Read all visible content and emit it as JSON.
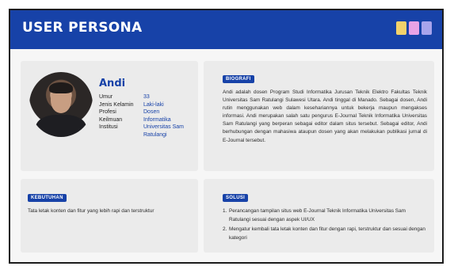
{
  "header": {
    "title": "USER PERSONA",
    "swatch_colors": [
      "#f3d26b",
      "#e8a3e6",
      "#a8a4ec"
    ]
  },
  "profile": {
    "name": "Andi",
    "attributes": [
      {
        "label": "Umur",
        "value": "33"
      },
      {
        "label": "Jenis Kelamin",
        "value": "Laki-laki"
      },
      {
        "label": "Profesi",
        "value": "Dosen"
      },
      {
        "label": "Keilmuan",
        "value": "Informatika"
      },
      {
        "label": "Institusi",
        "value": "Universitas Sam Ratulangi"
      }
    ]
  },
  "bio": {
    "badge": "BIOGRAFI",
    "text": "Andi adalah dosen Program Studi Informatika Jurusan Teknik Elektro Fakultas Teknik Universitas Sam Ratulangi Sulawesi Utara. Andi tinggal di Manado. Sebagai dosen, Andi rutin menggunakan web dalam kesehariannya untuk bekerja maupun mengakses informasi. Andi merupakan salah satu pengurus E-Journal Teknik Informatika Universitas Sam Ratulangi yang berperan sebagai editor dalam situs tersebut. Sebagai editor, Andi berhubungan dengan mahasiwa ataupun dosen yang akan melakukan publikasi jurnal di E-Journal tersebut."
  },
  "needs": {
    "badge": "KEBUTUHAN",
    "text": "Tata letak konten dan fitur yang lebih rapi dan terstruktur"
  },
  "solution": {
    "badge": "SOLUSI",
    "items": [
      {
        "num": "1.",
        "text": "Perancangan tampilan situs web E-Journal Teknik Informatika Universitas Sam Ratulangi sesuai dengan aspek UI/UX"
      },
      {
        "num": "2.",
        "text": "Mengatur kembali tata letak konten dan fitur dengan rapi, terstruktur dan sesuai dengan kategori"
      }
    ]
  }
}
